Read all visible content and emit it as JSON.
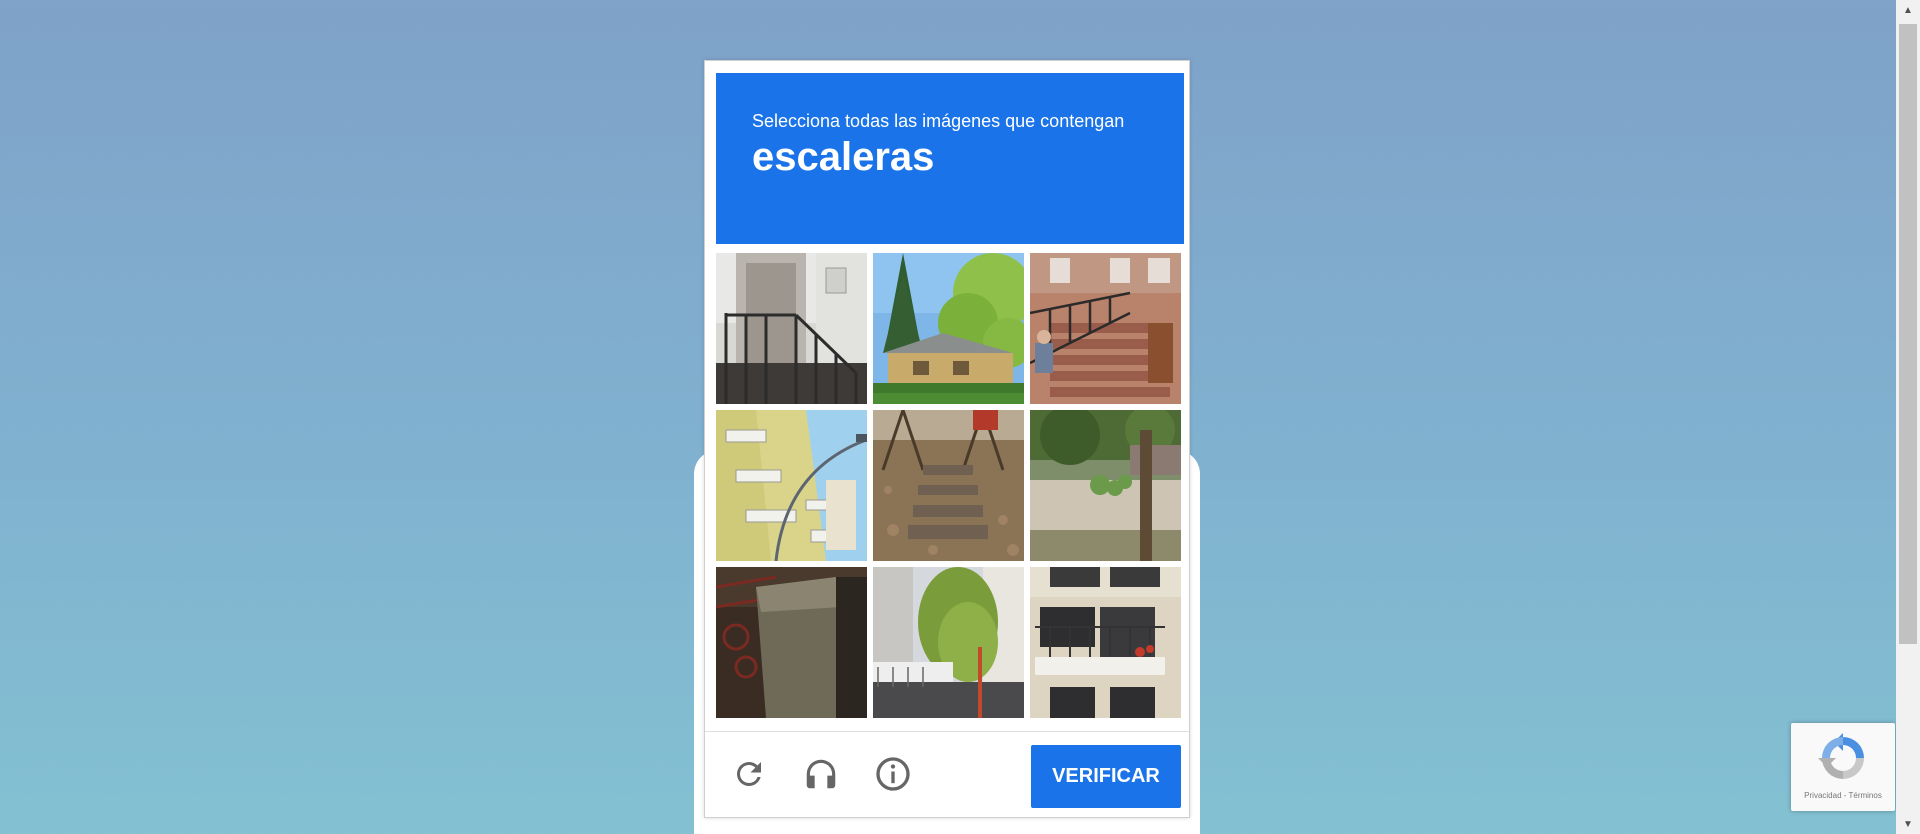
{
  "challenge": {
    "prompt": "Selecciona todas las imágenes que contengan",
    "target": "escaleras",
    "tiles": [
      {
        "subject": "white building with metal exterior staircase"
      },
      {
        "subject": "house with pine tree and green trees"
      },
      {
        "subject": "brick stoop staircase with railing"
      },
      {
        "subject": "yellow apartment balconies with street lamp"
      },
      {
        "subject": "stone steps in a park"
      },
      {
        "subject": "stone wall with tree and bushes"
      },
      {
        "subject": "stone pillar with ornate railing"
      },
      {
        "subject": "tree in front of building street"
      },
      {
        "subject": "apartment building with balconies"
      }
    ],
    "footer": {
      "reload_icon": "reload-icon",
      "audio_icon": "headphones-icon",
      "info_icon": "info-icon",
      "verify_label": "VERIFICAR"
    }
  },
  "badge": {
    "terms": "Privacidad - Términos"
  },
  "colors": {
    "accent": "#1a73e8",
    "background_top": "#7fa2c8",
    "background_bottom": "#83c1d2"
  }
}
